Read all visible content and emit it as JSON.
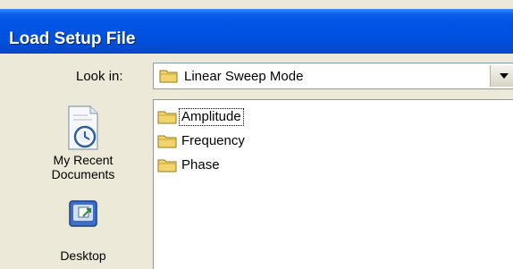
{
  "window": {
    "title": "Load Setup File"
  },
  "lookin": {
    "label": "Look in:",
    "value": "Linear Sweep Mode"
  },
  "places": [
    {
      "name": "recent",
      "label": "My Recent Documents"
    },
    {
      "name": "desktop",
      "label": "Desktop"
    }
  ],
  "files": [
    {
      "label": "Amplitude",
      "icon": "folder-icon"
    },
    {
      "label": "Frequency",
      "icon": "folder-icon"
    },
    {
      "label": "Phase",
      "icon": "folder-icon"
    }
  ],
  "colors": {
    "title_bar": "#0054e3",
    "dialog_bg": "#ece9d8",
    "folder": "#f2d56a"
  }
}
